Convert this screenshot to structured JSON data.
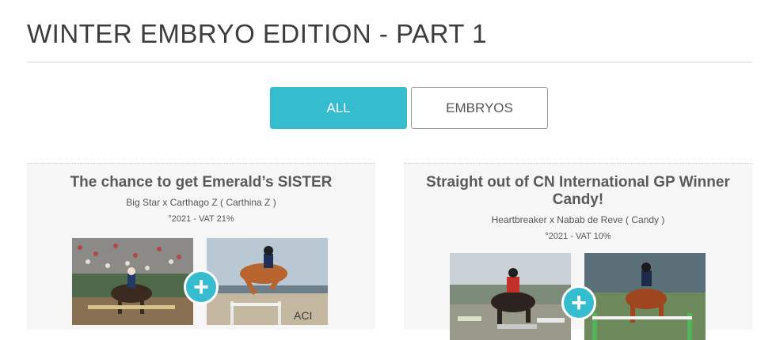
{
  "page": {
    "title": "WINTER EMBRYO EDITION - PART 1"
  },
  "filters": [
    {
      "label": "ALL",
      "active": true
    },
    {
      "label": "EMBRYOS",
      "active": false
    }
  ],
  "cards": [
    {
      "title": "The chance to get Emerald’s SISTER",
      "pedigree": "Big Star x Carthago Z ( Carthina Z )",
      "meta": "°2021 - VAT 21%"
    },
    {
      "title": "Straight out of CN International GP Winner Candy!",
      "pedigree": "Heartbreaker x Nabab de Reve ( Candy )",
      "meta": "°2021 - VAT 10%"
    }
  ],
  "icons": {
    "plus": "+"
  },
  "colors": {
    "accent": "#35bccf",
    "card_bg": "#f6f6f6"
  }
}
